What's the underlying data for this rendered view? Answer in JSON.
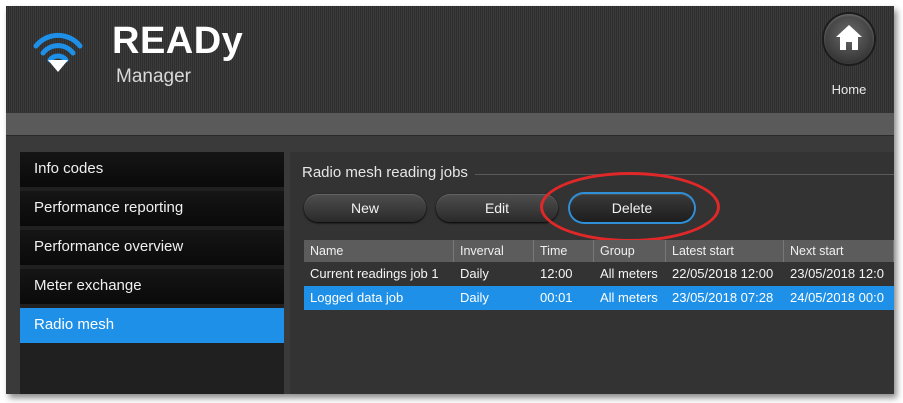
{
  "header": {
    "brand_title": "READy",
    "brand_subtitle": "Manager",
    "logo_icon": "wifi-download-icon",
    "home_icon": "home-icon",
    "home_label": "Home"
  },
  "sidebar": {
    "items": [
      {
        "label": "Info codes",
        "active": false
      },
      {
        "label": "Performance reporting",
        "active": false
      },
      {
        "label": "Performance overview",
        "active": false
      },
      {
        "label": "Meter exchange",
        "active": false
      },
      {
        "label": "Radio mesh",
        "active": true
      }
    ]
  },
  "main": {
    "section_title": "Radio mesh reading jobs",
    "buttons": {
      "new": "New",
      "edit": "Edit",
      "delete": "Delete"
    },
    "table": {
      "columns": [
        "Name",
        "Inverval",
        "Time",
        "Group",
        "Latest start",
        "Next start"
      ],
      "rows": [
        {
          "cells": [
            "Current readings job 1",
            "Daily",
            "12:00",
            "All meters",
            "22/05/2018 12:00",
            "23/05/2018 12:0"
          ],
          "selected": false
        },
        {
          "cells": [
            "Logged data job",
            "Daily",
            "00:01",
            "All meters",
            "23/05/2018 07:28",
            "24/05/2018 00:0"
          ],
          "selected": true
        }
      ]
    }
  },
  "colors": {
    "accent": "#1e90e8",
    "highlight_ring": "#e02828",
    "background": "#333333"
  }
}
